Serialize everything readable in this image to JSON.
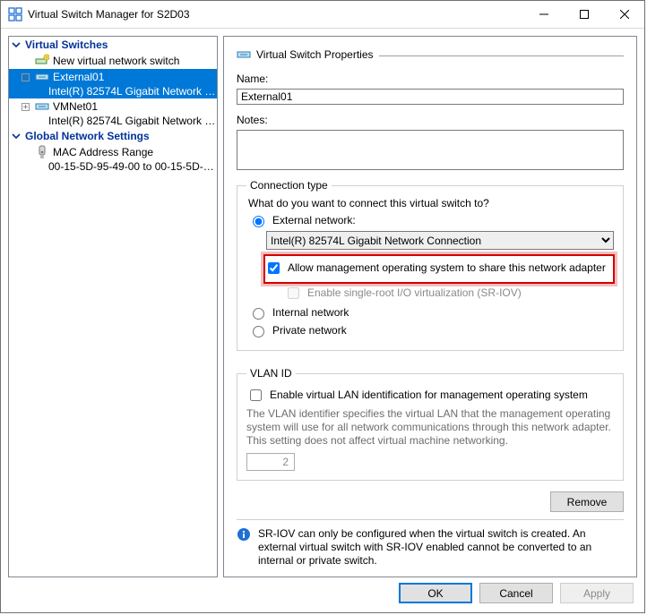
{
  "window": {
    "title": "Virtual Switch Manager for S2D03"
  },
  "tree": {
    "section_switches": "Virtual Switches",
    "new_switch": "New virtual network switch",
    "external": {
      "name": "External01",
      "adapter": "Intel(R) 82574L Gigabit Network C..."
    },
    "vmnet": {
      "name": "VMNet01",
      "adapter": "Intel(R) 82574L Gigabit Network C..."
    },
    "section_global": "Global Network Settings",
    "mac": {
      "label": "MAC Address Range",
      "range": "00-15-5D-95-49-00 to 00-15-5D-9..."
    }
  },
  "props": {
    "heading": "Virtual Switch Properties",
    "name_label": "Name:",
    "name_value": "External01",
    "notes_label": "Notes:",
    "notes_value": "",
    "ct": {
      "legend": "Connection type",
      "question": "What do you want to connect this virtual switch to?",
      "external": "External network:",
      "adapter": "Intel(R) 82574L Gigabit Network Connection",
      "allow_mgmt": "Allow management operating system to share this network adapter",
      "sriov": "Enable single-root I/O virtualization (SR-IOV)",
      "internal": "Internal network",
      "private": "Private network"
    },
    "vlan": {
      "legend": "VLAN ID",
      "enable": "Enable virtual LAN identification for management operating system",
      "hint": "The VLAN identifier specifies the virtual LAN that the management operating system will use for all network communications through this network adapter. This setting does not affect virtual machine networking.",
      "value": "2"
    },
    "sriov_info": "SR-IOV can only be configured when the virtual switch is created. An external virtual switch with SR-IOV enabled cannot be converted to an internal or private switch.",
    "remove": "Remove"
  },
  "buttons": {
    "ok": "OK",
    "cancel": "Cancel",
    "apply": "Apply"
  }
}
